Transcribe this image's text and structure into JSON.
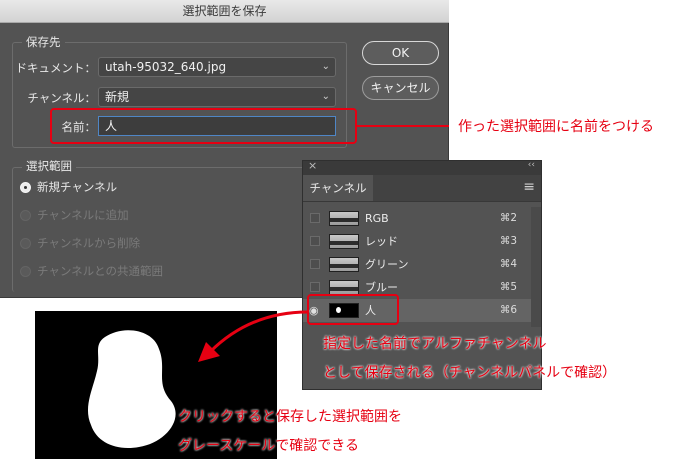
{
  "dialog": {
    "title": "選択範囲を保存",
    "save_to_legend": "保存先",
    "document_label": "ドキュメント：",
    "document_value": "utah-95032_640.jpg",
    "channel_label": "チャンネル：",
    "channel_value": "新規",
    "name_label": "名前：",
    "name_value": "人",
    "ok_label": "OK",
    "cancel_label": "キャンセル",
    "selection_legend": "選択範囲",
    "options": [
      {
        "label": "新規チャンネル",
        "selected": true,
        "enabled": true
      },
      {
        "label": "チャンネルに追加",
        "selected": false,
        "enabled": false
      },
      {
        "label": "チャンネルから削除",
        "selected": false,
        "enabled": false
      },
      {
        "label": "チャンネルとの共通範囲",
        "selected": false,
        "enabled": false
      }
    ]
  },
  "panel": {
    "close_glyph": "×",
    "collapse_glyph": "‹‹",
    "tab_label": "チャンネル",
    "menu_glyph": "≡",
    "channels": [
      {
        "name": "RGB",
        "shortcut": "⌘2",
        "visible": false,
        "thumb": "image"
      },
      {
        "name": "レッド",
        "shortcut": "⌘3",
        "visible": false,
        "thumb": "image"
      },
      {
        "name": "グリーン",
        "shortcut": "⌘4",
        "visible": false,
        "thumb": "image"
      },
      {
        "name": "ブルー",
        "shortcut": "⌘5",
        "visible": false,
        "thumb": "image"
      },
      {
        "name": "人",
        "shortcut": "⌘6",
        "visible": true,
        "thumb": "mask"
      }
    ]
  },
  "annotations": {
    "name_note": "作った選択範囲に名前をつける",
    "alpha_note_line1": "指定した名前でアルファチャンネル",
    "alpha_note_line2": "として保存される（チャンネルパネルで確認）",
    "grayscale_note_line1": "クリックすると保存した選択範囲を",
    "grayscale_note_line2": "グレースケールで確認できる"
  },
  "colors": {
    "accent_red": "#e60012",
    "dialog_bg": "#535353",
    "focus_blue": "#4f86c6"
  }
}
